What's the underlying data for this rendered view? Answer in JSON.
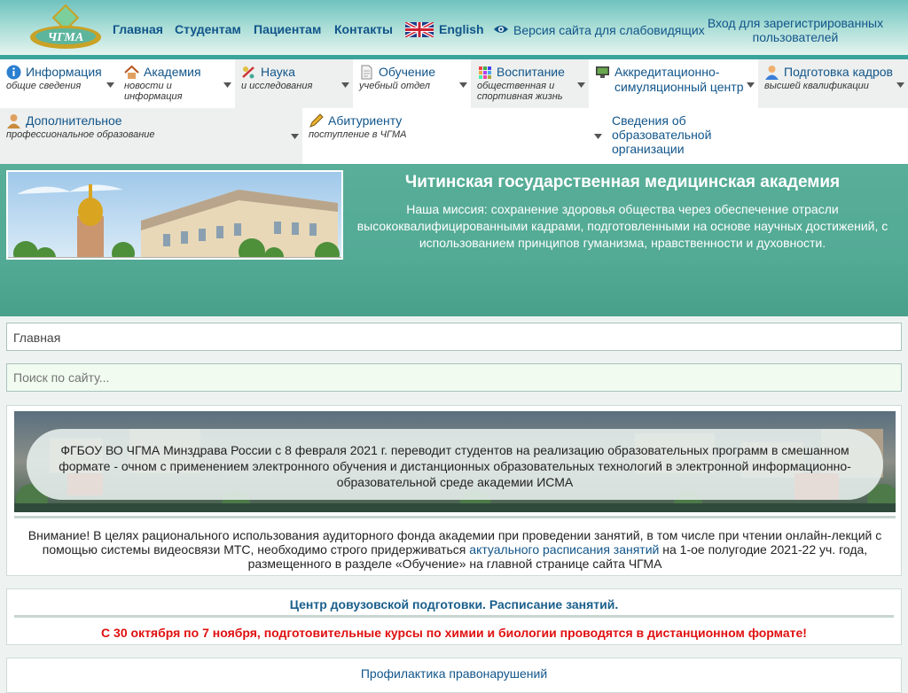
{
  "header": {
    "logo_text": "ЧГМА",
    "nav": [
      "Главная",
      "Студентам",
      "Пациентам",
      "Контакты"
    ],
    "english_label": "English",
    "accessibility_label": "Версия сайта для слабовидящих",
    "login_label": "Вход для зарегистрированных пользователей"
  },
  "menu": {
    "row1": [
      {
        "title": "Информация",
        "subtitle": "общие сведения",
        "icon": "info-icon"
      },
      {
        "title": "Академия",
        "subtitle": "новости и информация",
        "icon": "home-icon"
      },
      {
        "title": "Наука",
        "subtitle": "и исследования",
        "icon": "science-icon"
      },
      {
        "title": "Обучение",
        "subtitle": "учебный отдел",
        "icon": "document-icon"
      },
      {
        "title": "Воспитание",
        "subtitle": "общественная и спортивная жизнь",
        "icon": "grid-icon"
      },
      {
        "title": "Аккредитационно-симуляционный центр",
        "subtitle": "",
        "icon": "monitor-icon"
      },
      {
        "title": "Подготовка кадров",
        "subtitle": "высшей квалификации",
        "icon": "person-icon"
      }
    ],
    "row2": [
      {
        "title": "Дополнительное",
        "subtitle": "профессиональное образование",
        "icon": "person-edu-icon"
      },
      {
        "title": "Абитуриенту",
        "subtitle": "поступление в ЧГМА",
        "icon": "pencil-icon"
      },
      {
        "title": "Сведения об образовательной организации",
        "subtitle": "",
        "icon": ""
      }
    ]
  },
  "banner": {
    "title": "Читинская государственная медицинская академия",
    "mission": "Наша миссия: сохранение здоровья общества через обеспечение отрасли высококвалифицированными кадрами, подготовленными на основе научных достижений, с использованием принципов гуманизма, нравственности и духовности."
  },
  "breadcrumb": "Главная",
  "search": {
    "placeholder": "Поиск по сайту..."
  },
  "news": {
    "announcement": "ФГБОУ ВО ЧГМА Минздрава России с 8 февраля 2021 г. переводит студентов на реализацию образовательных программ в смешанном формате - очном с применением электронного обучения и дистанционных образовательных технологий в электронной информационно-образовательной среде академии ИСМА",
    "notice_before": "Внимание! В целях рационального использования аудиторного фонда академии при проведении занятий, в том числе при чтении онлайн-лекций с помощью системы видеосвязи МТС, необходимо строго придерживаться ",
    "notice_link": "актуального расписания занятий",
    "notice_after": " на 1-ое полугодие 2021-22 уч. года, размещенного в разделе «Обучение» на главной странице сайта ЧГМА"
  },
  "prep_center": {
    "title": "Центр довузовской подготовки. Расписание занятий.",
    "alert": "С 30 октября по 7 ноября, подготовительные курсы по химии и биологии проводятся в дистанционном формате!"
  },
  "prevention_link": "Профилактика правонарушений",
  "colors": {
    "accent": "#11558a",
    "banner": "#53aa95",
    "alert": "#e01010"
  }
}
